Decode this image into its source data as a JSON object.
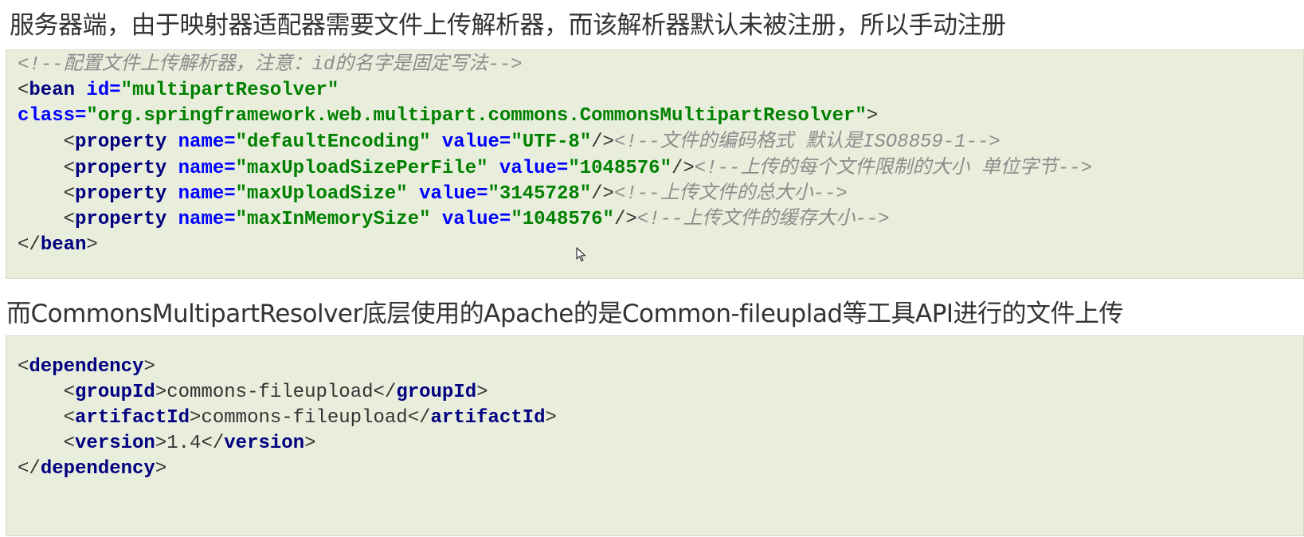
{
  "heading1": "服务器端，由于映射器适配器需要文件上传解析器，而该解析器默认未被注册，所以手动注册",
  "heading2": "而CommonsMultipartResolver底层使用的Apache的是Common-fileuplad等工具API进行的文件上传",
  "config_block": {
    "comment_header": "<!--配置文件上传解析器，注意：id的名字是固定写法-->",
    "bean_tag": "bean",
    "bean_id_attr": "id=",
    "bean_id_value": "\"multipartResolver\"",
    "bean_class_attr": "class=",
    "bean_class_value": "\"org.springframework.web.multipart.commons.CommonsMultipartResolver\"",
    "property_tag": "property",
    "name_attr": "name=",
    "value_attr": "value=",
    "properties": [
      {
        "name": "\"defaultEncoding\"",
        "value": "\"UTF-8\"",
        "comment": "<!--文件的编码格式 默认是ISO8859-1-->"
      },
      {
        "name": "\"maxUploadSizePerFile\"",
        "value": "\"1048576\"",
        "comment": "<!--上传的每个文件限制的大小 单位字节-->"
      },
      {
        "name": "\"maxUploadSize\"",
        "value": "\"3145728\"",
        "comment": "<!--上传文件的总大小-->"
      },
      {
        "name": "\"maxInMemorySize\"",
        "value": "\"1048576\"",
        "comment": "<!--上传文件的缓存大小-->"
      }
    ]
  },
  "dependency_block": {
    "dependency_tag": "dependency",
    "group_tag": "groupId",
    "group_value": "commons-fileupload",
    "artifact_tag": "artifactId",
    "artifact_value": "commons-fileupload",
    "version_tag": "version",
    "version_value": "1.4"
  },
  "colors": {
    "code_background": "#e8eedb",
    "tag": "#000080",
    "attribute": "#0000ff",
    "string_value": "#008000",
    "comment": "#8c8c8c"
  },
  "icons": [
    "mouse-cursor-icon"
  ]
}
